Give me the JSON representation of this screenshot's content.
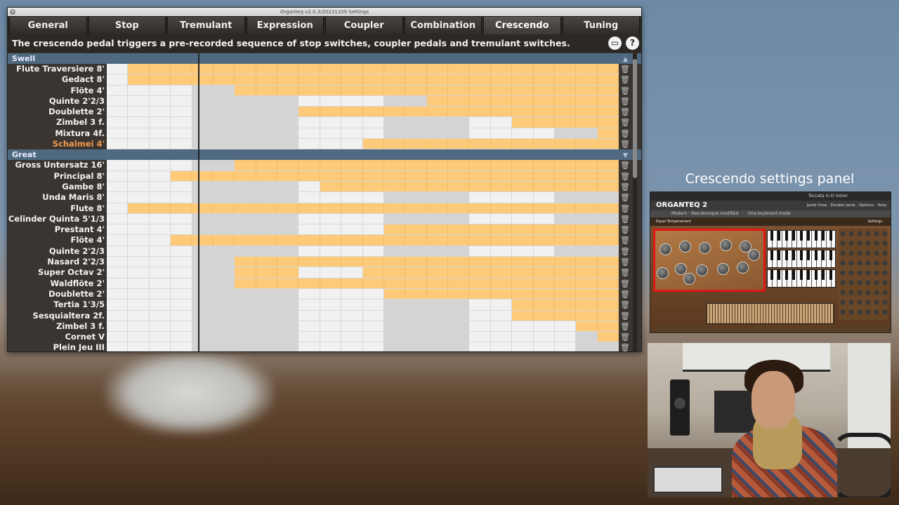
{
  "window": {
    "title": "Organteq v2.0.3/20231109 Settings",
    "close_icon": "close-icon"
  },
  "tabs": [
    "General",
    "Stop",
    "Tremulant",
    "Expression",
    "Coupler",
    "Combination",
    "Crescendo",
    "Tuning"
  ],
  "active_tab": "Crescendo",
  "description": "The crescendo pedal triggers a pre-recorded sequence of stop switches, coupler pedals and tremulant switches.",
  "desc_icons": {
    "window_icon": "window-icon",
    "help_label": "?"
  },
  "sections": [
    {
      "name": "Swell",
      "rows": [
        {
          "label": "Flute Traversiere 8'",
          "pattern": "wooooooooooooooooooooooo"
        },
        {
          "label": "Gedact 8'",
          "pattern": "wooooooooooooooooooooooo"
        },
        {
          "label": "Flöte 4'",
          "pattern": "wwwwggoooooooooooooooooo"
        },
        {
          "label": "Quinte 2'2/3",
          "pattern": "wwwwgggggwwwwggooooooooo"
        },
        {
          "label": "Doublette 2'",
          "pattern": "wwwwgggggooooooooooooooo"
        },
        {
          "label": "Zimbel 3 f.",
          "pattern": "wwwwgggggwwwwggggwwooooo"
        },
        {
          "label": "Mixtura 4f.",
          "pattern": "wwwwgggggwwwwggggwwwwggo"
        },
        {
          "label": "Schalmei 4'",
          "pattern": "wwwwgggggwwwoooooooooooo",
          "orange": true
        }
      ]
    },
    {
      "name": "Great",
      "rows": [
        {
          "label": "Gross Untersatz 16'",
          "pattern": "wwwwggoooooooooooooooooo"
        },
        {
          "label": "Principal 8'",
          "pattern": "wwwooooooooooooooooooooo"
        },
        {
          "label": "Gambe 8'",
          "pattern": "wwwwgggggwoooooooooooooo"
        },
        {
          "label": "Unda Maris 8'",
          "pattern": "wwwwgggggwwwwggggwwwwggg"
        },
        {
          "label": "Flute 8'",
          "pattern": "wooooooooooooooooooooooo"
        },
        {
          "label": "Celinder Quinta 5'1/3",
          "pattern": "wwwwgggggwwwwggggwwwwggg"
        },
        {
          "label": "Prestant 4'",
          "pattern": "wwwwgggggwwwwooooooooooo"
        },
        {
          "label": "Flöte 4'",
          "pattern": "wwwooooooooooooooooooooo"
        },
        {
          "label": "Quinte 2'2/3",
          "pattern": "wwwwgggggwwwwggggwwwwggg"
        },
        {
          "label": "Nasard 2'2/3",
          "pattern": "wwwwggoooooooooooooooooo"
        },
        {
          "label": "Super Octav 2'",
          "pattern": "wwwwggooowwwoooooooooooo"
        },
        {
          "label": "Waldflöte 2'",
          "pattern": "wwwwggoooooooooooooooooo"
        },
        {
          "label": "Doublette 2'",
          "pattern": "wwwwgggggwwwwooooooooooo"
        },
        {
          "label": "Tertia 1'3/5",
          "pattern": "wwwwgggggwwwwggggwwooooo"
        },
        {
          "label": "Sesquialtera 2f.",
          "pattern": "wwwwgggggwwwwggggwwooooo"
        },
        {
          "label": "Zimbel 3 f.",
          "pattern": "wwwwgggggwwwwggggwwwwwoo"
        },
        {
          "label": "Cornet V",
          "pattern": "wwwwgggggwwwwggggwwwwwgo"
        },
        {
          "label": "Plein Jeu III",
          "pattern": "wwwwgggggwwwwggggwwwwwgg"
        }
      ]
    }
  ],
  "side_caption": "Crescendo settings panel",
  "thumbnail": {
    "brand": "ORGANTEQ 2",
    "song": "Toccata in D minor",
    "menu": [
      "Jamb View",
      "Double jamb",
      "Options",
      "Help"
    ],
    "preset": "Modern · Neo-Baroque modified",
    "mode": "One keyboard mode",
    "temperament": "Equal Temperament",
    "settings": "Settings"
  },
  "colors": {
    "active": "#fcca78",
    "inactive_light": "#f1f1f1",
    "inactive_dark": "#d4d4d4",
    "section": "#4f6a80",
    "highlight": "#e21616"
  }
}
